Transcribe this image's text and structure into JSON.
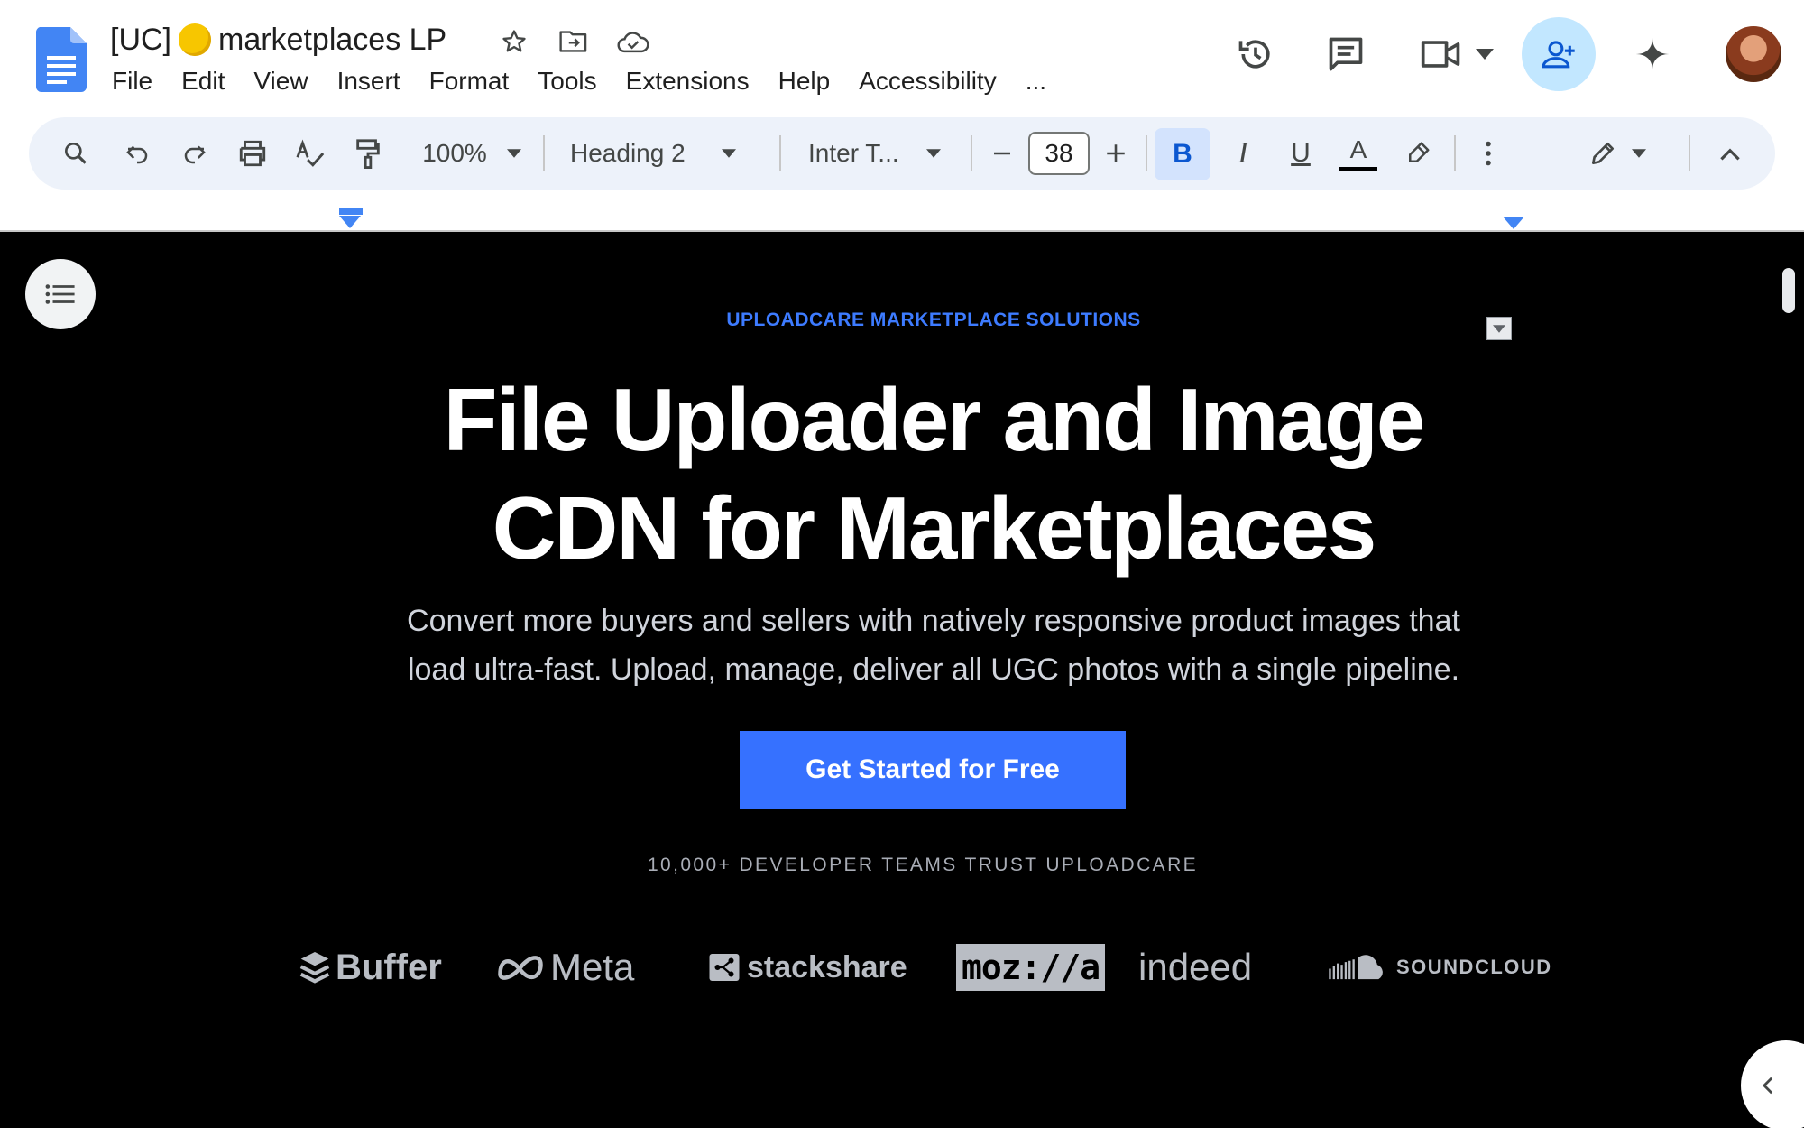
{
  "app": {
    "doc_title_prefix": "[UC]",
    "doc_title_suffix": "marketplaces LP"
  },
  "menu": {
    "items": [
      "File",
      "Edit",
      "View",
      "Insert",
      "Format",
      "Tools",
      "Extensions",
      "Help",
      "Accessibility",
      "..."
    ]
  },
  "toolbar": {
    "zoom": "100%",
    "style": "Heading 2",
    "font": "Inter T...",
    "font_size": "38",
    "bold": "B",
    "italic": "I",
    "underline": "U",
    "text_color": "A"
  },
  "document": {
    "eyebrow": "UPLOADCARE MARKETPLACE SOLUTIONS",
    "headline_line1": "File Uploader and Image",
    "headline_line2": "CDN for Marketplaces",
    "subhead_line1": "Convert more buyers and sellers with natively responsive product images that",
    "subhead_line2": "load ultra-fast. Upload, manage, deliver all UGC photos with a single pipeline.",
    "cta": "Get Started for Free",
    "trust": "10,000+ DEVELOPER TEAMS TRUST UPLOADCARE",
    "logos": {
      "buffer": "Buffer",
      "meta": "Meta",
      "stackshare": "stackshare",
      "mozilla": "moz://a",
      "indeed": "indeed",
      "soundcloud": "SOUNDCLOUD"
    }
  },
  "colors": {
    "accent": "#3671ff",
    "eyebrow": "#3d7bff",
    "toolbar_bg": "#edf2fa",
    "share_bg": "#c2e7ff",
    "canvas_bg": "#000000"
  }
}
